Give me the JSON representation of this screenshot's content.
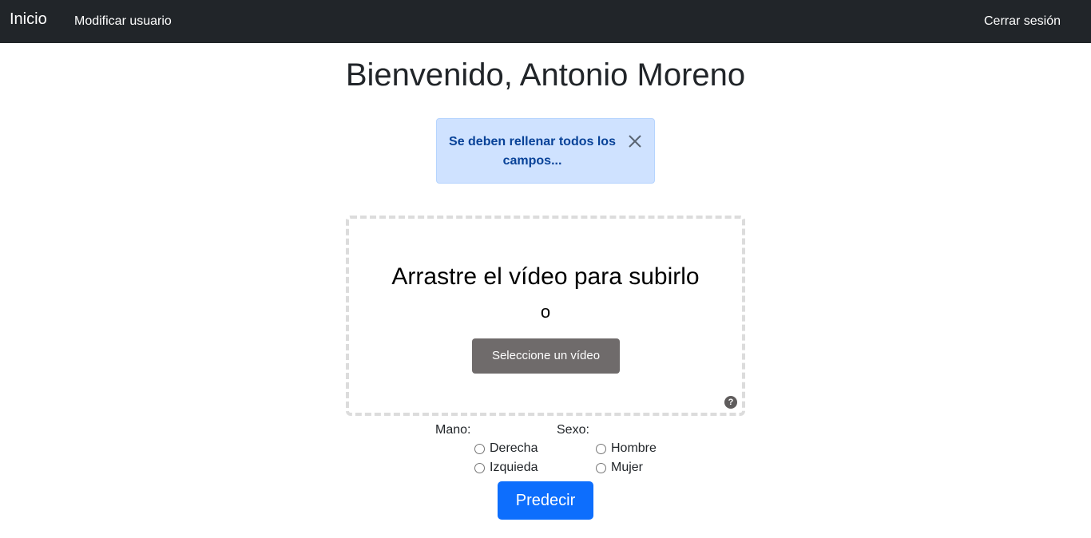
{
  "nav": {
    "brand": "Inicio",
    "modify_user": "Modificar usuario",
    "logout": "Cerrar sesión"
  },
  "welcome": "Bienvenido, Antonio Moreno",
  "alert": {
    "message": "Se deben rellenar todos los campos...",
    "close_icon": "close-icon"
  },
  "upload": {
    "title": "Arrastre el vídeo para subirlo",
    "or": "o",
    "button": "Seleccione un vídeo",
    "help_icon": "?"
  },
  "form": {
    "mano_label": "Mano:",
    "mano_options": [
      "Derecha",
      "Izquieda"
    ],
    "sexo_label": "Sexo:",
    "sexo_options": [
      "Hombre",
      "Mujer"
    ],
    "submit": "Predecir"
  },
  "colors": {
    "navbar": "#212529",
    "alert_bg": "#cfe2ff",
    "alert_text": "#084298",
    "primary": "#0d6efd",
    "secondary_button": "#6f6b6b"
  }
}
